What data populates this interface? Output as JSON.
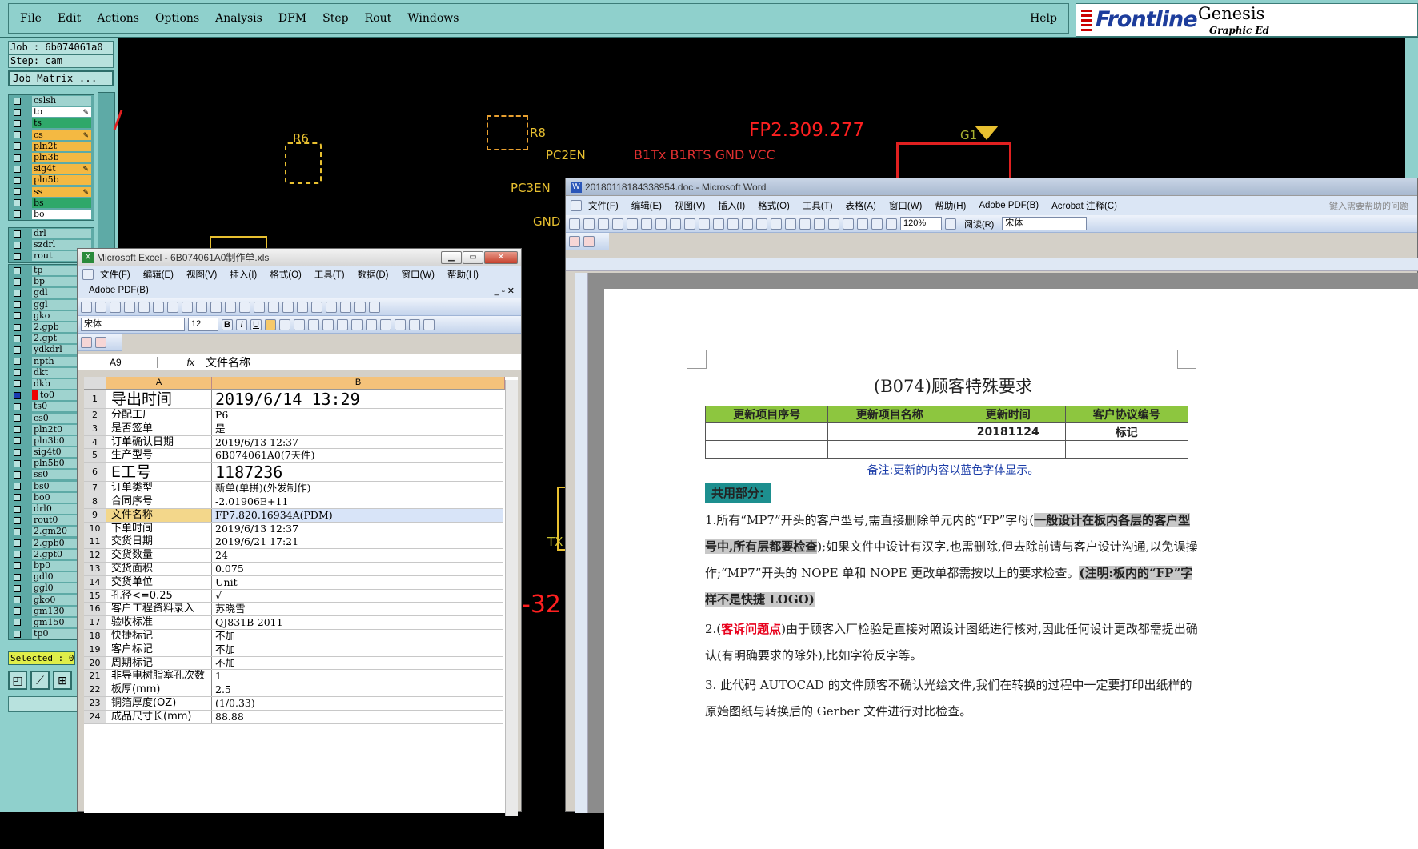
{
  "genesis": {
    "menu": [
      "File",
      "Edit",
      "Actions",
      "Options",
      "Analysis",
      "DFM",
      "Step",
      "Rout",
      "Windows"
    ],
    "help": "Help",
    "logo": {
      "brand": "Frontline",
      "product": "Genesis",
      "tagline": "Graphic Ed"
    },
    "job": "Job : 6b074061a0",
    "step": "Step: cam",
    "job_matrix": "Job Matrix ...",
    "layers_top": [
      {
        "name": "cslsh",
        "color": "#9fd3cf",
        "check": false
      },
      {
        "name": "to",
        "color": "#ffffff",
        "check": false,
        "pen": true
      },
      {
        "name": "ts",
        "color": "#2fa86a",
        "check": false
      },
      {
        "name": "cs",
        "color": "#f4b942",
        "check": false,
        "pen": true
      },
      {
        "name": "pln2t",
        "color": "#f4b942",
        "check": false
      },
      {
        "name": "pln3b",
        "color": "#f4b942",
        "check": false
      },
      {
        "name": "sig4t",
        "color": "#f4b942",
        "check": false,
        "pen": true
      },
      {
        "name": "pln5b",
        "color": "#f4b942",
        "check": false
      },
      {
        "name": "ss",
        "color": "#f4b942",
        "check": false,
        "pen": true
      },
      {
        "name": "bs",
        "color": "#2fa86a",
        "check": false
      },
      {
        "name": "bo",
        "color": "#ffffff",
        "check": false
      }
    ],
    "layers_mid": [
      {
        "name": "drl",
        "color": "#9fd3cf"
      },
      {
        "name": "szdrl",
        "color": "#9fd3cf"
      },
      {
        "name": "rout",
        "color": "#9fd3cf"
      }
    ],
    "layers_bottom": [
      "tp",
      "bp",
      "gdl",
      "ggl",
      "gko",
      "2.gpb",
      "2.gpt",
      "ydkdrl",
      "npth",
      "dkt",
      "dkb",
      "to0",
      "ts0",
      "cs0",
      "pln2t0",
      "pln3b0",
      "sig4t0",
      "pln5b0",
      "ss0",
      "bs0",
      "bo0",
      "drl0",
      "rout0",
      "2.gm20",
      "2.gpb0",
      "2.gpt0",
      "bp0",
      "gdl0",
      "ggl0",
      "gko0",
      "gm130",
      "gm150",
      "tp0"
    ],
    "selected": "Selected : 0",
    "canvas_labels": {
      "r6": "R6",
      "r8": "R8",
      "pc2en": "PC2EN",
      "pc3en": "PC3EN",
      "gnd": "GND",
      "fp": "FP2.309.277",
      "b1": "B1Tx B1RTS GND VCC",
      "g1": "G1",
      "tx": "TX",
      "num": "-32"
    }
  },
  "excel": {
    "title": "Microsoft Excel - 6B074061A0制作单.xls",
    "menu": [
      "文件(F)",
      "编辑(E)",
      "视图(V)",
      "插入(I)",
      "格式(O)",
      "工具(T)",
      "数据(D)",
      "窗口(W)",
      "帮助(H)"
    ],
    "menu2": "Adobe PDF(B)",
    "font": "宋体",
    "size": "12",
    "cell_ref": "A9",
    "fx": "fx",
    "formula": "文件名称",
    "col_a": "A",
    "col_b": "B",
    "rows": [
      {
        "n": "1",
        "a": "导出时间",
        "b": "2019/6/14 13:29",
        "big": true
      },
      {
        "n": "2",
        "a": "分配工厂",
        "b": "P6"
      },
      {
        "n": "3",
        "a": "是否签单",
        "b": "是"
      },
      {
        "n": "4",
        "a": "订单确认日期",
        "b": "2019/6/13 12:37"
      },
      {
        "n": "5",
        "a": "生产型号",
        "b": "6B074061A0(7天件)"
      },
      {
        "n": "6",
        "a": "E工号",
        "b": "1187236",
        "big": true
      },
      {
        "n": "7",
        "a": "订单类型",
        "b": "新单(单拼)(外发制作)"
      },
      {
        "n": "8",
        "a": "合同序号",
        "b": "-2.01906E+11"
      },
      {
        "n": "9",
        "a": "文件名称",
        "b": "FP7.820.16934A(PDM)",
        "sel": true
      },
      {
        "n": "10",
        "a": "下单时间",
        "b": "2019/6/13 12:37"
      },
      {
        "n": "11",
        "a": "交货日期",
        "b": "2019/6/21 17:21"
      },
      {
        "n": "12",
        "a": "交货数量",
        "b": "24"
      },
      {
        "n": "13",
        "a": "交货面积",
        "b": "0.075"
      },
      {
        "n": "14",
        "a": "交货单位",
        "b": "Unit"
      },
      {
        "n": "15",
        "a": "孔径<=0.25",
        "b": "√"
      },
      {
        "n": "16",
        "a": "客户工程资料录入",
        "b": "苏晓雪"
      },
      {
        "n": "17",
        "a": "验收标准",
        "b": "QJ831B-2011"
      },
      {
        "n": "18",
        "a": "快捷标记",
        "b": "不加"
      },
      {
        "n": "19",
        "a": "客户标记",
        "b": "不加"
      },
      {
        "n": "20",
        "a": "周期标记",
        "b": "不加"
      },
      {
        "n": "21",
        "a": "非导电树脂塞孔次数",
        "b": "1"
      },
      {
        "n": "22",
        "a": "板厚(mm)",
        "b": "2.5"
      },
      {
        "n": "23",
        "a": "铜箔厚度(OZ)",
        "b": "(1/0.33)"
      },
      {
        "n": "24",
        "a": "成品尺寸长(mm)",
        "b": "88.88"
      }
    ]
  },
  "word": {
    "title": "20180118184338954.doc - Microsoft Word",
    "menu": [
      "文件(F)",
      "编辑(E)",
      "视图(V)",
      "插入(I)",
      "格式(O)",
      "工具(T)",
      "表格(A)",
      "窗口(W)",
      "帮助(H)",
      "Adobe PDF(B)",
      "Acrobat 注释(C)"
    ],
    "help_placeholder": "键入需要帮助的问题",
    "zoom": "120%",
    "read": "阅读(R)",
    "font": "宋体",
    "doc_title": "(B074)顾客特殊要求",
    "table_headers": [
      "更新项目序号",
      "更新项目名称",
      "更新时间",
      "客户协议编号"
    ],
    "table_row1": [
      "",
      "",
      "20181124",
      "标记"
    ],
    "table_row2": [
      "",
      "",
      "",
      ""
    ],
    "note": "备注:更新的内容以蓝色字体显示。",
    "section": "共用部分:",
    "p1a": "1.所有“MP7”开头的客户型号,需直接删除单元内的“FP”字母(",
    "p1b": "一般设计在板内各层的客户型号中,所有层都要检查",
    "p1c": ");如果文件中设计有汉字,也需删除,但去除前请与客户设计沟通,以免误操作;“MP7”开头的 NOPE 单和 NOPE 更改单都需按以上的要求检查。",
    "p1d": "(注明:板内的“FP”字样不是快捷 LOGO)",
    "p2a": "2.(",
    "p2b": "客诉问题点",
    "p2c": ")由于顾客入厂检验是直接对照设计图纸进行核对,因此任何设计更改都需提出确认(有明确要求的除外),比如字符反字等。",
    "p3": "3. 此代码 AUTOCAD 的文件顾客不确认光绘文件,我们在转换的过程中一定要打印出纸样的原始图纸与转换后的 Gerber 文件进行对比检查。"
  }
}
